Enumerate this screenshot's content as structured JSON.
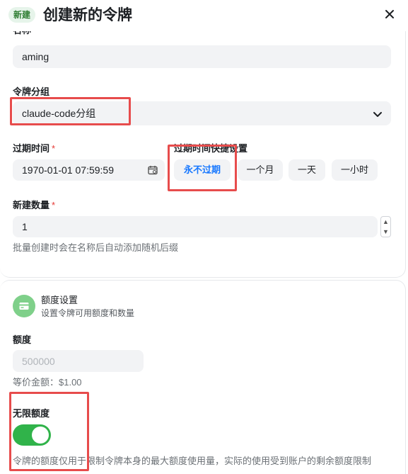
{
  "header": {
    "badge": "新建",
    "title": "创建新的令牌"
  },
  "form": {
    "name_value": "aming",
    "group": {
      "label": "令牌分组",
      "value": "claude-code分组"
    },
    "expiry": {
      "label": "过期时间",
      "value": "1970-01-01 07:59:59"
    },
    "quick_expiry": {
      "label": "过期时间快捷设置",
      "options": [
        "永不过期",
        "一个月",
        "一天",
        "一小时"
      ],
      "active": "永不过期"
    },
    "count": {
      "label": "新建数量",
      "value": "1",
      "help": "批量创建时会在名称后自动添加随机后缀"
    }
  },
  "quota_section": {
    "title": "额度设置",
    "subtitle": "设置令牌可用额度和数量",
    "quota_label": "额度",
    "quota_placeholder": "500000",
    "equiv_amount": "等价金额：$1.00",
    "unlimited_label": "无限额度",
    "unlimited_on": true,
    "note": "令牌的额度仅用于限制令牌本身的最大额度使用量，实际的使用受到账户的剩余额度限制"
  },
  "colors": {
    "accent": "#1677ff",
    "toggle_on": "#30b34a",
    "badge_bg": "#e6f4ea",
    "badge_text": "#2e7d32",
    "highlight": "#e74c4c",
    "required": "#e53935"
  }
}
